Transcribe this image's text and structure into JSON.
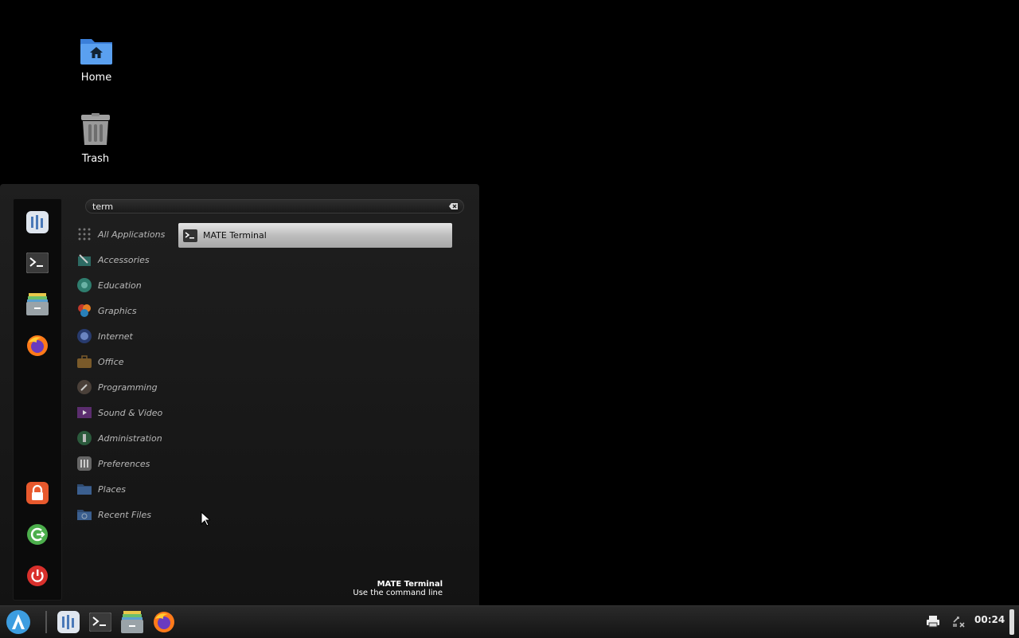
{
  "desktop": {
    "icons": [
      {
        "label": "Home",
        "icon": "home-folder-icon"
      },
      {
        "label": "Trash",
        "icon": "trash-icon"
      }
    ]
  },
  "menu": {
    "search": {
      "value": "term"
    },
    "favorites": [
      "system-monitor",
      "terminal",
      "file-manager",
      "firefox"
    ],
    "session": [
      "lock-screen",
      "logout",
      "shutdown"
    ],
    "categories": [
      "All Applications",
      "Accessories",
      "Education",
      "Graphics",
      "Internet",
      "Office",
      "Programming",
      "Sound & Video",
      "Administration",
      "Preferences",
      "Places",
      "Recent Files"
    ],
    "results": [
      {
        "name": "MATE Terminal"
      }
    ],
    "description": {
      "name": "MATE Terminal",
      "text": "Use the command line"
    }
  },
  "taskbar": {
    "launchers": [
      "app-menu",
      "system-monitor",
      "terminal",
      "file-manager",
      "firefox"
    ],
    "clock": "00:24"
  },
  "colors": {
    "accent": "#3d9de0",
    "lock": "#e8592d",
    "logout": "#4cae4c",
    "power": "#d9302c"
  }
}
